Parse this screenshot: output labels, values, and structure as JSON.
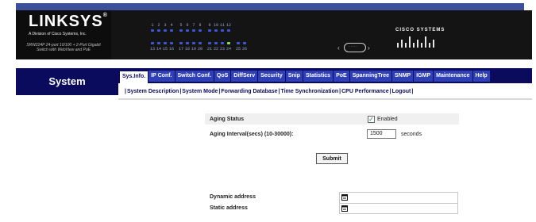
{
  "header": {
    "brand": "LINKSYS",
    "brand_reg": "®",
    "brand_sub": "A Division of Cisco Systems, Inc.",
    "model_line1": "SRW224P 24-port 10/100 + 2-Port Gigabit",
    "model_line2": "Switch with WebView and PoE",
    "ports_top": [
      "1",
      "2",
      "3",
      "4",
      "5",
      "6",
      "7",
      "8",
      "9",
      "10",
      "11",
      "12"
    ],
    "ports_bottom": [
      "13",
      "14",
      "15",
      "16",
      "17",
      "18",
      "19",
      "20",
      "21",
      "22",
      "23",
      "24",
      "25",
      "26"
    ],
    "cisco_text": "CISCO SYSTEMS"
  },
  "section": {
    "title": "System"
  },
  "tabs": [
    {
      "label": "Sys.Info.",
      "active": true
    },
    {
      "label": "IP Conf.",
      "active": false
    },
    {
      "label": "Switch Conf.",
      "active": false
    },
    {
      "label": "QoS",
      "active": false
    },
    {
      "label": "DiffServ",
      "active": false
    },
    {
      "label": "Security",
      "active": false
    },
    {
      "label": "Snip",
      "active": false
    },
    {
      "label": "Statistics",
      "active": false
    },
    {
      "label": "PoE",
      "active": false
    },
    {
      "label": "SpanningTree",
      "active": false
    },
    {
      "label": "SNMP",
      "active": false
    },
    {
      "label": "IGMP",
      "active": false
    },
    {
      "label": "Maintenance",
      "active": false
    },
    {
      "label": "Help",
      "active": false
    }
  ],
  "sublinks": [
    "System Description",
    "System Mode",
    "Forwarding Database",
    "Time Synchronization",
    "CPU Performance",
    "Logout"
  ],
  "sublink_sep": "|",
  "form": {
    "aging_status_label": "Aging Status",
    "aging_status_checked": true,
    "aging_status_check_mark": "✓",
    "enabled_label": "Enabled",
    "aging_interval_label": "Aging Interval(secs) (10-30000):",
    "aging_interval_value": "1500",
    "seconds_label": "seconds",
    "submit_label": "Submit",
    "dynamic_address_label": "Dynamic address",
    "static_address_label": "Static address"
  },
  "colors": {
    "nav_bg": "#0b0b5e",
    "tab_bg": "#2f3fb8",
    "header_bg": "#141414",
    "topbar": "#3e4f9a",
    "led": "#3b56d9",
    "led_active": "#7be85a"
  }
}
